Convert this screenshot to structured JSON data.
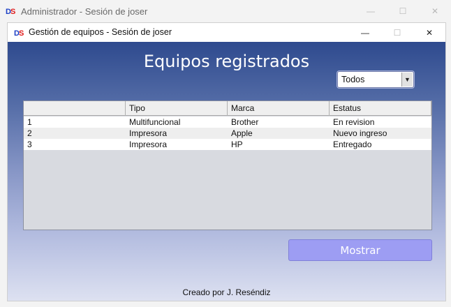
{
  "outer_window": {
    "logo_text": "DS",
    "title": "Administrador - Sesión de joser"
  },
  "inner_window": {
    "logo_text": "DS",
    "title": "Gestión de equipos - Sesión de joser"
  },
  "main": {
    "heading": "Equipos registrados",
    "filter": {
      "selected": "Todos"
    },
    "table": {
      "columns": [
        "",
        "Tipo",
        "Marca",
        "Estatus"
      ],
      "rows": [
        [
          "1",
          "Multifuncional",
          "Brother",
          "En revision"
        ],
        [
          "2",
          "Impresora",
          "Apple",
          "Nuevo ingreso"
        ],
        [
          "3",
          "Impresora",
          "HP",
          "Entregado"
        ]
      ]
    },
    "show_button": "Mostrar",
    "footer": "Creado por J. Reséndiz"
  },
  "colors": {
    "logo_blue": "#1b3fc5",
    "logo_red": "#e01b1b",
    "button": "#9d9df3"
  }
}
